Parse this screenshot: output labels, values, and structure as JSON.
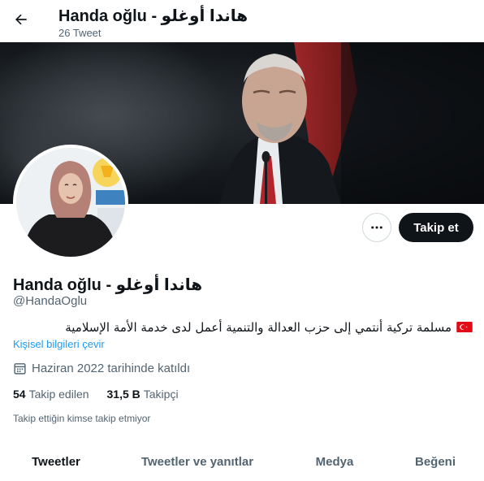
{
  "header": {
    "back_icon": "arrow-left-icon",
    "title": "Handa oğlu - هاندا أوغلو",
    "tweet_count": "26 Tweet"
  },
  "profile": {
    "display_name": "Handa oğlu - هاندا أوغلو",
    "handle": "@HandaOglu",
    "bio": "مسلمة تركية أنتمي إلى حزب العدالة والتنمية أعمل لدى خدمة الأمة الإسلامية",
    "bio_flag": "turkey-flag-icon",
    "translate_label": "Kişisel bilgileri çevir",
    "joined": "Haziran 2022 tarihinde katıldı",
    "following_count": "54",
    "following_label": "Takip edilen",
    "followers_count": "31,5 B",
    "followers_label": "Takipçi",
    "followed_by_note": "Takip ettiğin kimse takip etmiyor"
  },
  "actions": {
    "more_icon": "more-dots-icon",
    "follow_label": "Takip et"
  },
  "tabs": [
    {
      "label": "Tweetler",
      "active": true
    },
    {
      "label": "Tweetler ve yanıtlar",
      "active": false
    },
    {
      "label": "Medya",
      "active": false
    },
    {
      "label": "Beğeni",
      "active": false
    }
  ],
  "colors": {
    "accent": "#1d9bf0",
    "text": "#0f1419",
    "secondary": "#536471",
    "button_dark": "#0f1419"
  }
}
